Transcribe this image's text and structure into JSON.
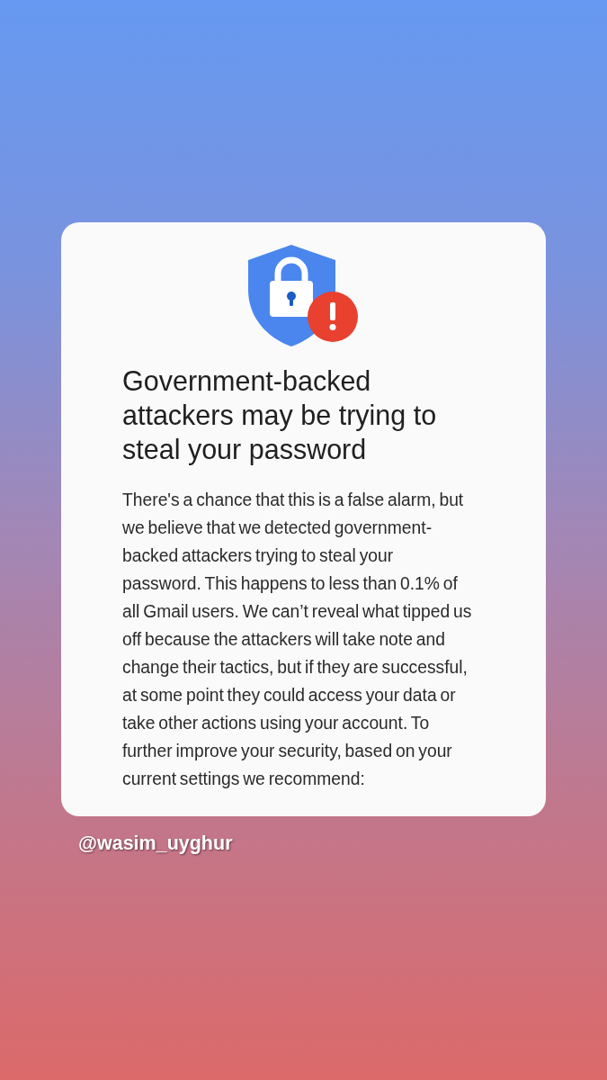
{
  "alert_card": {
    "title": "Government-backed attackers may be trying to steal your password",
    "body": "There's a chance that this is a false alarm, but we believe that we detected government-backed attackers trying to steal your password. This happens to less than 0.1% of all Gmail users. We can’t reveal what tipped us off because the attackers will take note and change their tactics, but if they are successful, at some point they could access your data or take other actions using your account. To further improve your security, based on your current settings we recommend:"
  },
  "handle": "@wasim_uyghur"
}
